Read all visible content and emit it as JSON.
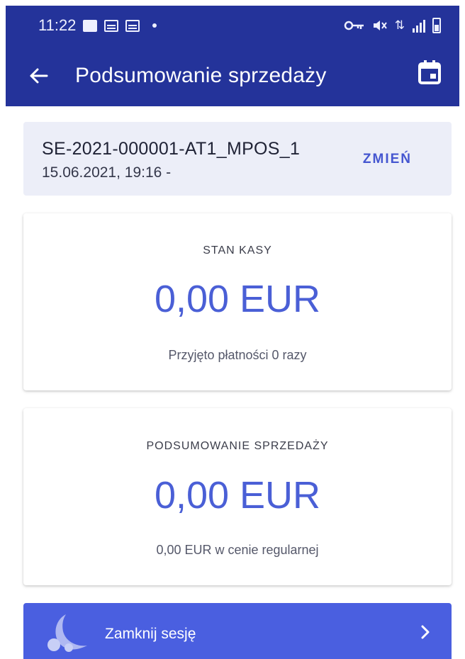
{
  "status_bar": {
    "time": "11:22",
    "icons_left": [
      "image-icon",
      "calendar-icon",
      "calendar-icon"
    ],
    "icons_right": [
      "vpn-key-icon",
      "mute-icon",
      "data-icon",
      "signal-icon",
      "battery-icon"
    ]
  },
  "app_bar": {
    "title": "Podsumowanie sprzedaży",
    "back_icon": "arrow-left-icon",
    "action_icon": "calendar-icon"
  },
  "session": {
    "id": "SE-2021-000001-AT1_MPOS_1",
    "date": "15.06.2021, 19:16 -",
    "change_label": "ZMIEŃ"
  },
  "cash_state": {
    "label": "STAN KASY",
    "amount": "0,00 EUR",
    "subtitle": "Przyjęto płatności 0 razy"
  },
  "sales_summary": {
    "label": "PODSUMOWANIE SPRZEDAŻY",
    "amount": "0,00 EUR",
    "subtitle": "0,00 EUR w cenie regularnej"
  },
  "close_session": {
    "label": "Zamknij sesję",
    "icon": "moon-icon"
  },
  "colors": {
    "app_bar": "#24339a",
    "accent": "#4a5fd6",
    "button": "#4a5fe0",
    "session_card": "#eceef8"
  }
}
